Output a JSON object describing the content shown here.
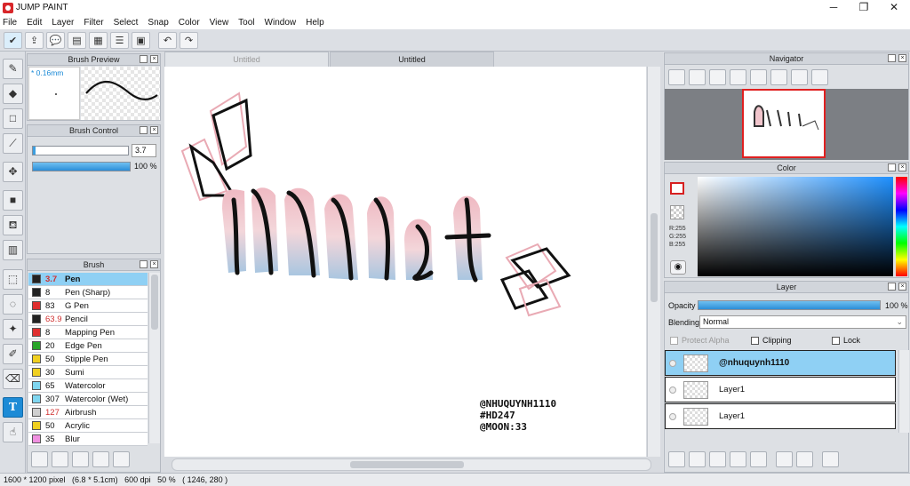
{
  "window": {
    "title": "JUMP PAINT",
    "minimize": "─",
    "maximize": "❐",
    "close": "✕"
  },
  "menu": [
    "File",
    "Edit",
    "Layer",
    "Filter",
    "Select",
    "Snap",
    "Color",
    "View",
    "Tool",
    "Window",
    "Help"
  ],
  "brush_preview": {
    "title": "Brush Preview",
    "size_label": "* 0.16mm"
  },
  "brush_control": {
    "title": "Brush Control",
    "size_value": "3.7",
    "opacity_value": "100 %",
    "size_fraction": 0.03,
    "opacity_fraction": 1.0
  },
  "brush_list": {
    "title": "Brush",
    "items": [
      {
        "size": "3.7",
        "name": "Pen",
        "color": "#222222",
        "size_color": "#d03030",
        "selected": true
      },
      {
        "size": "8",
        "name": "Pen (Sharp)",
        "color": "#222222"
      },
      {
        "size": "83",
        "name": "G Pen",
        "color": "#e03030"
      },
      {
        "size": "63.9",
        "name": "Pencil",
        "color": "#222222",
        "size_color": "#d03030"
      },
      {
        "size": "8",
        "name": "Mapping Pen",
        "color": "#e03030"
      },
      {
        "size": "20",
        "name": "Edge Pen",
        "color": "#2aa52a"
      },
      {
        "size": "50",
        "name": "Stipple Pen",
        "color": "#f0d020"
      },
      {
        "size": "30",
        "name": "Sumi",
        "color": "#f0d020"
      },
      {
        "size": "65",
        "name": "Watercolor",
        "color": "#7fd6f0"
      },
      {
        "size": "307",
        "name": "Watercolor (Wet)",
        "color": "#7fd6f0"
      },
      {
        "size": "127",
        "name": "Airbrush",
        "color": "#cfcfcf",
        "size_color": "#d03030"
      },
      {
        "size": "50",
        "name": "Acrylic",
        "color": "#f0d020"
      },
      {
        "size": "35",
        "name": "Blur",
        "color": "#f090e0"
      }
    ]
  },
  "tabs": [
    {
      "label": "Untitled"
    },
    {
      "label": "Untitled"
    }
  ],
  "canvas": {
    "signature": [
      "@NHUQUYNH1110",
      "#HD247",
      "@MOON:33"
    ]
  },
  "navigator": {
    "title": "Navigator"
  },
  "color_panel": {
    "title": "Color",
    "r": "R:255",
    "g": "G:255",
    "b": "B:255"
  },
  "layer_panel": {
    "title": "Layer",
    "opacity_label": "Opacity",
    "opacity_value": "100 %",
    "opacity_fraction": 1.0,
    "blending_label": "Blending",
    "blending_value": "Normal",
    "protect_alpha": "Protect Alpha",
    "clipping": "Clipping",
    "lock": "Lock",
    "layers": [
      {
        "name": "@nhuquynh1110",
        "selected": true
      },
      {
        "name": "Layer1"
      },
      {
        "name": "Layer1"
      }
    ]
  },
  "status": {
    "text": "1600 * 1200 pixel   (6.8 * 5.1cm)   600 dpi   50 %   ( 1246, 280 )"
  }
}
